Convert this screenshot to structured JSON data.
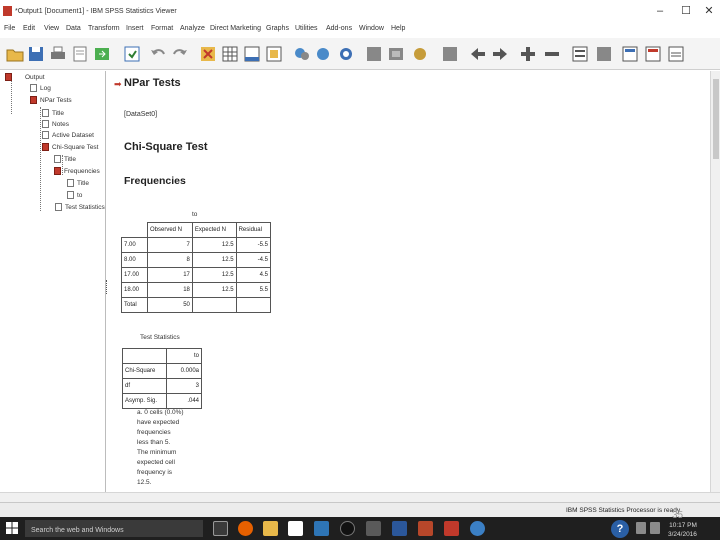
{
  "window": {
    "title": "*Output1 [Document1] - IBM SPSS Statistics Viewer",
    "min": "–",
    "max": "☐",
    "close": "✕"
  },
  "menu": [
    "File",
    "Edit",
    "View",
    "Data",
    "Transform",
    "Insert",
    "Format",
    "Analyze",
    "Direct Marketing",
    "Graphs",
    "Utilities",
    "Add-ons",
    "Window",
    "Help"
  ],
  "toolbar_icons": [
    "open-icon",
    "save-icon",
    "print-icon",
    "print-preview-icon",
    "export-icon",
    "recall-dialog-icon",
    "undo-icon",
    "redo-icon",
    "goto-data-icon",
    "goto-case-icon",
    "goto-variable-icon",
    "variables-icon",
    "chart-builder-icon",
    "select-cases-icon",
    "weight-cases-icon",
    "split-file-icon",
    "value-labels-icon",
    "use-sets-icon",
    "script-icon",
    "designate-window-icon",
    "back-arrow-icon",
    "forward-arrow-icon",
    "expand-icon",
    "collapse-icon",
    "show-icon",
    "hide-icon",
    "insert-heading-icon"
  ],
  "outline": {
    "items": [
      "Output",
      "Log",
      "NPar Tests",
      "Title",
      "Notes",
      "Active Dataset",
      "Chi-Square Test",
      "Title",
      "Frequencies",
      "Title",
      "to",
      "Test Statistics"
    ]
  },
  "content": {
    "heading": "NPar Tests",
    "dataset": "[DataSet0]",
    "test_heading": "Chi-Square Test",
    "freq_heading": "Frequencies",
    "freq_table": {
      "title": "to",
      "columns": [
        "",
        "Observed N",
        "Expected N",
        "Residual"
      ],
      "rows": [
        [
          "7.00",
          "7",
          "12.5",
          "-5.5"
        ],
        [
          "8.00",
          "8",
          "12.5",
          "-4.5"
        ],
        [
          "17.00",
          "17",
          "12.5",
          "4.5"
        ],
        [
          "18.00",
          "18",
          "12.5",
          "5.5"
        ],
        [
          "Total",
          "50",
          "",
          ""
        ]
      ]
    },
    "stats_table": {
      "title": "Test Statistics",
      "column": "to",
      "rows": [
        [
          "Chi-Square",
          "0.000a"
        ],
        [
          "df",
          "3"
        ],
        [
          "Asymp. Sig.",
          ".044"
        ]
      ]
    },
    "footnote_lines": [
      "a. 0 cells (0.0%)",
      "have expected",
      "frequencies",
      "less than 5.",
      "The minimum",
      "expected cell",
      "frequency is",
      "12.5."
    ]
  },
  "statusbar": {
    "text": "IBM SPSS Statistics Processor is ready"
  },
  "taskbar": {
    "search_placeholder": "Search the web and Windows",
    "time": "10:17 PM",
    "date": "3/24/2016"
  },
  "page_number": "35"
}
